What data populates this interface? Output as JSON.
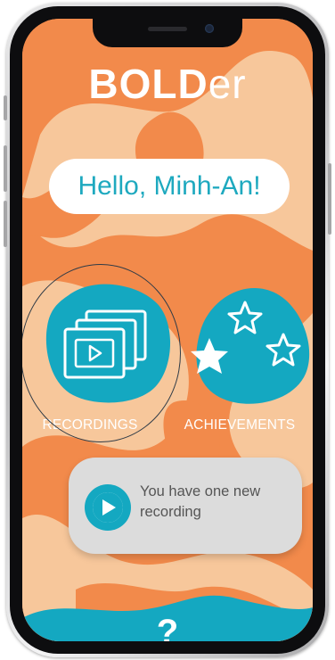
{
  "app": {
    "logo_bold": "BOLD",
    "logo_light": "er"
  },
  "greeting": "Hello, Minh-An!",
  "tiles": [
    {
      "id": "recordings",
      "label": "RECORDINGS",
      "icon": "video-stack-icon"
    },
    {
      "id": "achievements",
      "label": "ACHIEVEMENTS",
      "icon": "stars-icon"
    }
  ],
  "notification": {
    "text": "You have one new recording",
    "icon": "play-icon"
  },
  "help": {
    "label": "?",
    "icon": "help-icon"
  },
  "colors": {
    "background": "#f28a4b",
    "accent": "#14a8c1",
    "light_shape": "#f7c79b",
    "card": "#dcdcdc",
    "white": "#ffffff"
  }
}
